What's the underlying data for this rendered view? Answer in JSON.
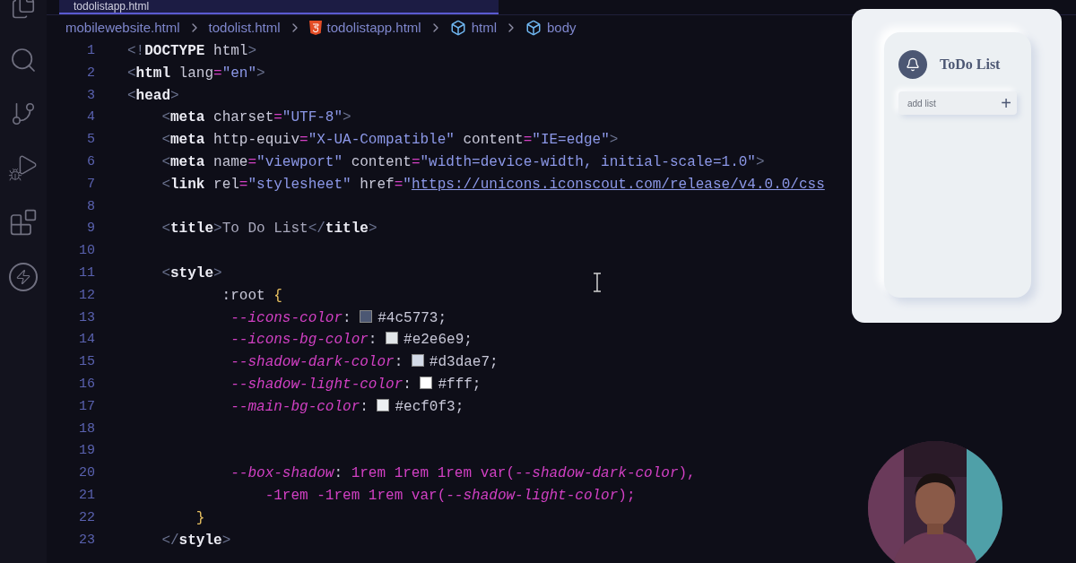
{
  "tab": {
    "label": "todolistapp.html",
    "selected": true
  },
  "breadcrumb": [
    {
      "label": "mobilewebsite.html",
      "kind": "file"
    },
    {
      "label": "todolist.html",
      "kind": "file"
    },
    {
      "label": "todolistapp.html",
      "kind": "html5"
    },
    {
      "label": "html",
      "kind": "element"
    },
    {
      "label": "body",
      "kind": "element"
    }
  ],
  "code_lines": [
    {
      "number": "1",
      "tokens": [
        {
          "kind": "punct",
          "s": "<!"
        },
        {
          "kind": "tag",
          "s": "DOCTYPE"
        },
        {
          "kind": "plain",
          "s": " html"
        },
        {
          "kind": "punct",
          "s": ">"
        }
      ]
    },
    {
      "number": "2",
      "tokens": [
        {
          "kind": "punct",
          "s": "<"
        },
        {
          "kind": "tag",
          "s": "html"
        },
        {
          "kind": "attr",
          "s": " lang"
        },
        {
          "kind": "value",
          "s": "="
        },
        {
          "kind": "string",
          "s": "\"en\""
        },
        {
          "kind": "punct",
          "s": ">"
        }
      ]
    },
    {
      "number": "3",
      "tokens": [
        {
          "kind": "punct",
          "s": "<"
        },
        {
          "kind": "tag",
          "s": "head"
        },
        {
          "kind": "punct",
          "s": ">"
        }
      ]
    },
    {
      "number": "4",
      "tokens": [
        {
          "kind": "punct",
          "s": "    <"
        },
        {
          "kind": "tag",
          "s": "meta"
        },
        {
          "kind": "attr",
          "s": " charset"
        },
        {
          "kind": "value",
          "s": "="
        },
        {
          "kind": "string",
          "s": "\"UTF-8\""
        },
        {
          "kind": "punct",
          "s": ">"
        }
      ]
    },
    {
      "number": "5",
      "tokens": [
        {
          "kind": "punct",
          "s": "    <"
        },
        {
          "kind": "tag",
          "s": "meta"
        },
        {
          "kind": "attr",
          "s": " http-equiv"
        },
        {
          "kind": "value",
          "s": "="
        },
        {
          "kind": "string",
          "s": "\"X-UA-Compatible\""
        },
        {
          "kind": "attr",
          "s": " content"
        },
        {
          "kind": "value",
          "s": "="
        },
        {
          "kind": "string",
          "s": "\"IE=edge\""
        },
        {
          "kind": "punct",
          "s": ">"
        }
      ]
    },
    {
      "number": "6",
      "tokens": [
        {
          "kind": "punct",
          "s": "    <"
        },
        {
          "kind": "tag",
          "s": "meta"
        },
        {
          "kind": "attr",
          "s": " name"
        },
        {
          "kind": "value",
          "s": "="
        },
        {
          "kind": "string",
          "s": "\"viewport\""
        },
        {
          "kind": "attr",
          "s": " content"
        },
        {
          "kind": "value",
          "s": "="
        },
        {
          "kind": "string",
          "s": "\"width=device-width, initial-scale=1.0\""
        },
        {
          "kind": "punct",
          "s": ">"
        }
      ]
    },
    {
      "number": "7",
      "tokens": [
        {
          "kind": "punct",
          "s": "    <"
        },
        {
          "kind": "tag",
          "s": "link"
        },
        {
          "kind": "attr",
          "s": " rel"
        },
        {
          "kind": "value",
          "s": "="
        },
        {
          "kind": "string",
          "s": "\"stylesheet\""
        },
        {
          "kind": "attr",
          "s": " href"
        },
        {
          "kind": "value",
          "s": "="
        },
        {
          "kind": "string",
          "s": "\""
        },
        {
          "kind": "url",
          "s": "https://unicons.iconscout.com/release/v4.0.0/css"
        }
      ]
    },
    {
      "number": "8"
    },
    {
      "number": "9",
      "tokens": [
        {
          "kind": "punct",
          "s": "    <"
        },
        {
          "kind": "tag",
          "s": "title"
        },
        {
          "kind": "punct",
          "s": ">"
        },
        {
          "kind": "text",
          "s": "To Do List"
        },
        {
          "kind": "punct",
          "s": "</"
        },
        {
          "kind": "tag",
          "s": "title"
        },
        {
          "kind": "punct",
          "s": ">"
        }
      ]
    },
    {
      "number": "10"
    },
    {
      "number": "11",
      "tokens": [
        {
          "kind": "punct",
          "s": "    <"
        },
        {
          "kind": "tag",
          "s": "style"
        },
        {
          "kind": "punct",
          "s": ">"
        }
      ]
    },
    {
      "number": "12",
      "tokens": [
        {
          "kind": "plain",
          "s": "           :root "
        },
        {
          "kind": "brace",
          "s": "{"
        }
      ]
    },
    {
      "number": "13",
      "tokens": [
        {
          "kind": "property",
          "s": "            --icons-color"
        },
        {
          "kind": "plain",
          "s": ": "
        },
        {
          "kind": "swatch",
          "color": "#4c5773"
        },
        {
          "kind": "plain",
          "s": "#4c5773;"
        }
      ]
    },
    {
      "number": "14",
      "tokens": [
        {
          "kind": "property",
          "s": "            --icons-bg-color"
        },
        {
          "kind": "plain",
          "s": ": "
        },
        {
          "kind": "swatch",
          "color": "#e2e6e9"
        },
        {
          "kind": "plain",
          "s": "#e2e6e9;"
        }
      ]
    },
    {
      "number": "15",
      "tokens": [
        {
          "kind": "property",
          "s": "            --shadow-dark-color"
        },
        {
          "kind": "plain",
          "s": ": "
        },
        {
          "kind": "swatch",
          "color": "#d3dae7"
        },
        {
          "kind": "plain",
          "s": "#d3dae7;"
        }
      ]
    },
    {
      "number": "16",
      "tokens": [
        {
          "kind": "property",
          "s": "            --shadow-light-color"
        },
        {
          "kind": "plain",
          "s": ": "
        },
        {
          "kind": "swatch",
          "color": "#ffffff"
        },
        {
          "kind": "plain",
          "s": "#fff;"
        }
      ]
    },
    {
      "number": "17",
      "tokens": [
        {
          "kind": "property",
          "s": "            --main-bg-color"
        },
        {
          "kind": "plain",
          "s": ": "
        },
        {
          "kind": "swatch",
          "color": "#ecf0f3"
        },
        {
          "kind": "plain",
          "s": "#ecf0f3;"
        }
      ]
    },
    {
      "number": "18"
    },
    {
      "number": "19"
    },
    {
      "number": "20",
      "tokens": [
        {
          "kind": "property",
          "s": "            --box-shadow"
        },
        {
          "kind": "plain",
          "s": ": "
        },
        {
          "kind": "value",
          "s": "1rem 1rem 1rem var("
        },
        {
          "kind": "property",
          "s": "--shadow-dark-color"
        },
        {
          "kind": "value",
          "s": "),"
        }
      ]
    },
    {
      "number": "21",
      "tokens": [
        {
          "kind": "value",
          "s": "                -1rem -1rem 1rem var("
        },
        {
          "kind": "property",
          "s": "--shadow-light-color"
        },
        {
          "kind": "value",
          "s": ");"
        }
      ]
    },
    {
      "number": "22",
      "tokens": [
        {
          "kind": "brace",
          "s": "        }"
        }
      ]
    },
    {
      "number": "23",
      "tokens": [
        {
          "kind": "punct",
          "s": "    </"
        },
        {
          "kind": "tag",
          "s": "style"
        },
        {
          "kind": "punct",
          "s": ">"
        }
      ]
    }
  ],
  "preview": {
    "title": "ToDo List",
    "input": {
      "placeholder": "add list"
    },
    "add_button": "+"
  }
}
